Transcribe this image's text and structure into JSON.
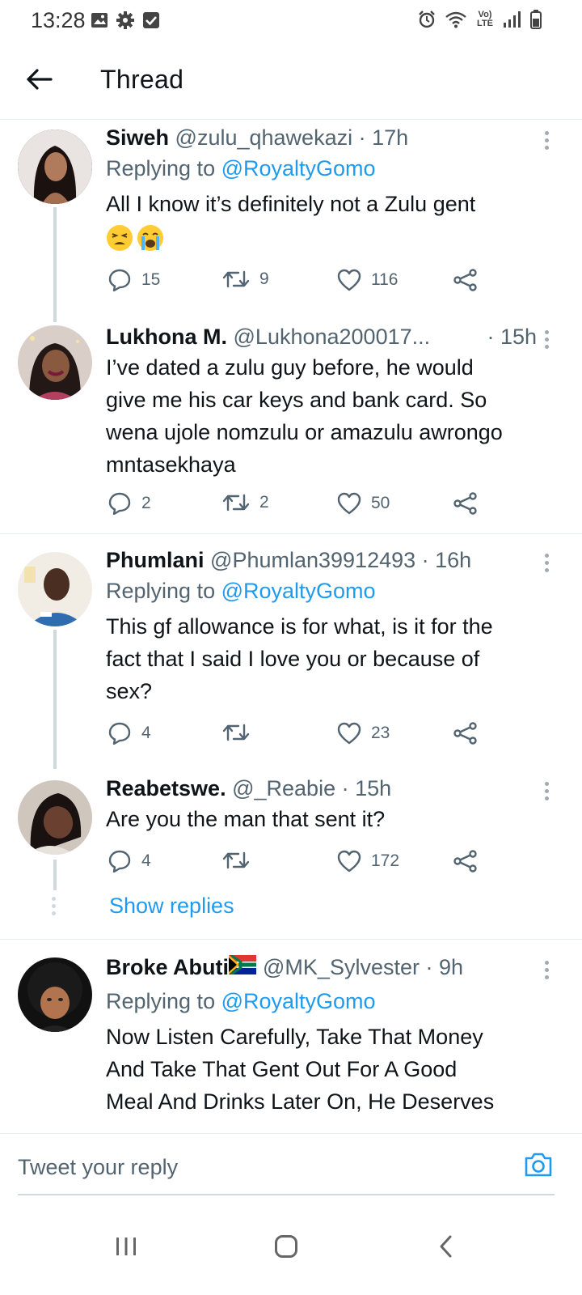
{
  "status_bar": {
    "time": "13:28",
    "left_icons": [
      "image-icon",
      "gear-icon",
      "checkbox-icon"
    ],
    "right_icons": [
      "alarm-icon",
      "wifi-icon",
      "volte-icon",
      "signal-icon",
      "battery-icon"
    ],
    "volte_label": "Vo) LTE"
  },
  "header": {
    "title": "Thread",
    "back_icon": "arrow-left-icon"
  },
  "tweets": [
    {
      "name": "Siweh",
      "handle": "@zulu_qhawekazi · 17h",
      "replying_prefix": "Replying to ",
      "replying_mention": "@RoyaltyGomo",
      "text": "All I know it’s definitely not a Zulu gent",
      "emojis": [
        "tired-face-emoji",
        "crying-face-emoji"
      ],
      "replies": "15",
      "retweets": "9",
      "likes": "116"
    },
    {
      "name": "Lukhona M.",
      "handle": "@Lukhona200017...",
      "time": "· 15h",
      "text_lines": [
        "I’ve dated a zulu guy before, he would",
        "give me his car keys and bank card. So",
        "wena ujole nomzulu or amazulu awrongo",
        "mntasekhaya"
      ],
      "replies": "2",
      "retweets": "2",
      "likes": "50"
    },
    {
      "name": "Phumlani",
      "handle": "@Phumlan39912493 · 16h",
      "replying_prefix": "Replying to ",
      "replying_mention": "@RoyaltyGomo",
      "text_lines": [
        "This gf allowance is for what, is it for the",
        "fact that I said I love you or because of",
        "sex?"
      ],
      "replies": "4",
      "retweets": "",
      "likes": "23"
    },
    {
      "name": "Reabetswe.",
      "handle": "@_Reabie · 15h",
      "text": "Are you the man that sent it?",
      "replies": "4",
      "retweets": "",
      "likes": "172"
    },
    {
      "name": "Broke Abuti",
      "flag": "south-africa-flag-emoji",
      "handle": "@MK_Sylvester · 9h",
      "replying_prefix": "Replying to ",
      "replying_mention": "@RoyaltyGomo",
      "text_lines": [
        "Now Listen Carefully, Take That Money",
        "And Take That Gent Out For A Good",
        "Meal And Drinks Later On, He Deserves"
      ]
    }
  ],
  "show_replies": "Show replies",
  "reply_bar": {
    "placeholder": "Tweet your reply",
    "camera_icon": "camera-icon"
  },
  "nav_bar": {
    "icons": [
      "recent-apps-icon",
      "home-icon",
      "back-icon"
    ]
  },
  "colors": {
    "accent": "#1d9bf0",
    "text": "#0f1419",
    "secondary": "#536471",
    "line": "#cfd9de"
  }
}
